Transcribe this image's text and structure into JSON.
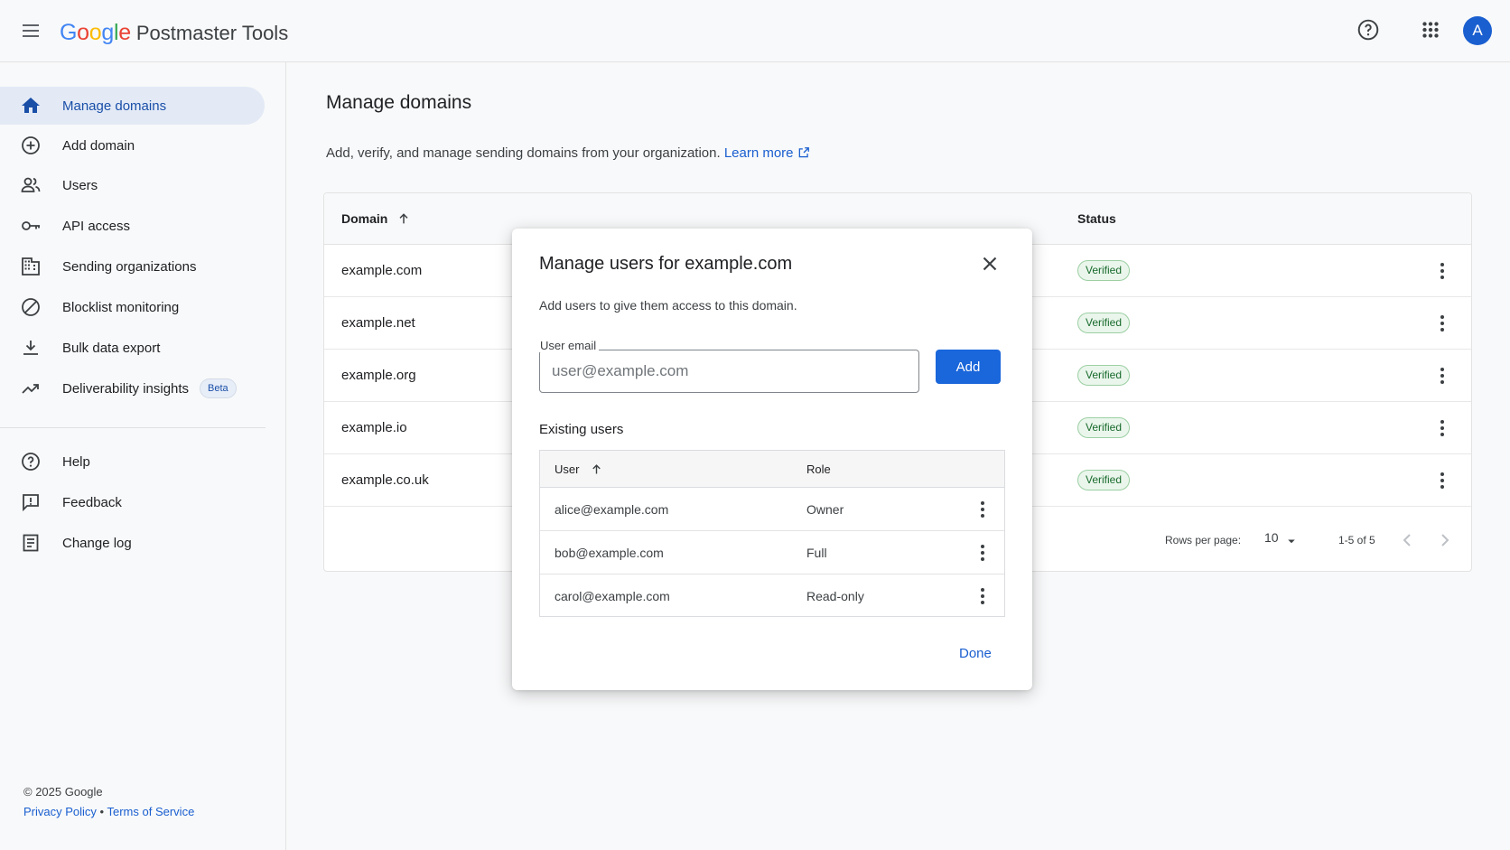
{
  "header": {
    "logo_letters": [
      "G",
      "o",
      "o",
      "g",
      "l",
      "e"
    ],
    "logo_colors": [
      "#4285F4",
      "#EA4335",
      "#FBBC05",
      "#4285F4",
      "#34A853",
      "#EA4335"
    ],
    "product_name": "Postmaster Tools",
    "avatar_letter": "A",
    "icons": [
      "menu-icon",
      "help-icon",
      "apps-grid-icon"
    ]
  },
  "sidebar": {
    "items": [
      {
        "label": "Manage domains",
        "icon": "home-icon",
        "active": true
      },
      {
        "label": "Add domain",
        "icon": "add-circle-icon"
      },
      {
        "label": "Users",
        "icon": "users-icon"
      },
      {
        "label": "API access",
        "icon": "key-icon"
      },
      {
        "label": "Sending organizations",
        "icon": "building-icon"
      },
      {
        "label": "Blocklist monitoring",
        "icon": "block-icon"
      },
      {
        "label": "Bulk data export",
        "icon": "download-icon"
      },
      {
        "label": "Deliverability insights",
        "icon": "trending-up-icon",
        "badge": "Beta"
      }
    ],
    "secondary_items": [
      {
        "label": "Help",
        "icon": "help-icon"
      },
      {
        "label": "Feedback",
        "icon": "feedback-icon"
      },
      {
        "label": "Change log",
        "icon": "changelog-icon"
      }
    ],
    "footer": {
      "copyright": "© 2025 Google",
      "privacy": "Privacy Policy",
      "separator": "•",
      "terms": "Terms of Service"
    }
  },
  "main": {
    "title": "Manage domains",
    "description": "Add, verify, and manage sending domains from your organization.",
    "learn_more": "Learn more",
    "table": {
      "col_domain": "Domain",
      "col_status": "Status",
      "rows": [
        {
          "domain": "example.com",
          "status": "Verified"
        },
        {
          "domain": "example.net",
          "status": "Verified"
        },
        {
          "domain": "example.org",
          "status": "Verified"
        },
        {
          "domain": "example.io",
          "status": "Verified"
        },
        {
          "domain": "example.co.uk",
          "status": "Verified"
        }
      ],
      "rows_per_page_label": "Rows per page:",
      "rows_per_page_value": "10",
      "range": "1-5 of 5"
    }
  },
  "dialog": {
    "title": "Manage users for example.com",
    "description": "Add users to give them access to this domain.",
    "email_label": "User email",
    "email_placeholder": "user@example.com",
    "email_value": "",
    "add_label": "Add",
    "existing_title": "Existing users",
    "col_user": "User",
    "col_role": "Role",
    "users": [
      {
        "email": "alice@example.com",
        "role": "Owner"
      },
      {
        "email": "bob@example.com",
        "role": "Full"
      },
      {
        "email": "carol@example.com",
        "role": "Read-only"
      }
    ],
    "done_label": "Done"
  },
  "colors": {
    "accent": "#1a66db",
    "link": "#1a5fd0",
    "active_nav_bg": "#e3eaf6",
    "verified_green": "#186a2c"
  }
}
